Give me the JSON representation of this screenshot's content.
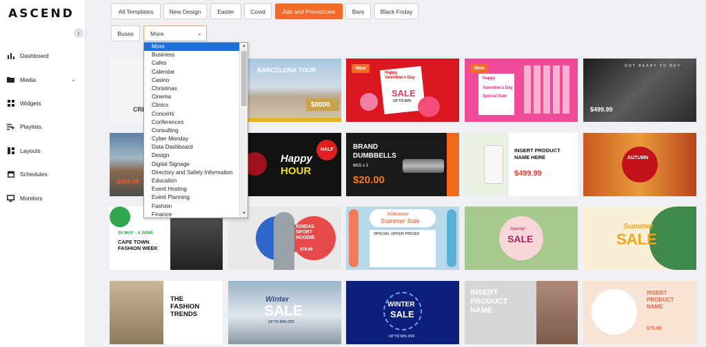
{
  "app": {
    "logo": "ASCEND",
    "collapse_icon": "chevron-left-icon"
  },
  "sidebar": {
    "items": [
      {
        "label": "Dashboard",
        "icon": "bar-chart-icon"
      },
      {
        "label": "Media",
        "icon": "folder-icon",
        "has_chevron": true
      },
      {
        "label": "Widgets",
        "icon": "grid-icon"
      },
      {
        "label": "Playlists",
        "icon": "playlist-icon"
      },
      {
        "label": "Layouts",
        "icon": "layout-icon"
      },
      {
        "label": "Schedules",
        "icon": "calendar-icon"
      },
      {
        "label": "Monitors",
        "icon": "monitor-icon"
      }
    ]
  },
  "filters": {
    "chips": [
      "All Templates",
      "New Design",
      "Easter",
      "Covid",
      "Ads and Promotions",
      "Bars",
      "Black Friday",
      "Buses"
    ],
    "active": "Ads and Promotions",
    "select_value": "More",
    "accent": "#f36b2a"
  },
  "dropdown": {
    "options": [
      "More",
      "Business",
      "Cafes",
      "Calendar",
      "Casino",
      "Christmas",
      "Cinema",
      "Clinics",
      "Concerts",
      "Conferences",
      "Consulting",
      "Cyber Monday",
      "Data Dashboard",
      "Design",
      "Digital Signage",
      "Directory and Safety Information",
      "Education",
      "Event Hosting",
      "Event Planning",
      "Fashion",
      "Finance"
    ],
    "selected": "More",
    "highlight": "#1e6fd9"
  },
  "templates": {
    "new_badge": "New",
    "c1": {
      "text": "CRE"
    },
    "c2": {
      "title": "BARCELONA TOUR",
      "price": "$0000"
    },
    "c3": {
      "line1": "Happy",
      "line2": "Valentine's Day",
      "sale": "SALE",
      "sub": "UP TO 50%"
    },
    "c4": {
      "line1": "Happy",
      "line2": "Valentine's Day",
      "line3": "Special Sale"
    },
    "c5": {
      "tag": "GOT READY TO BUY",
      "price": "$499.99"
    },
    "c6": {
      "price": "$499.99"
    },
    "c7": {
      "badge": "HALF",
      "line1": "Happy",
      "line2": "HOUR"
    },
    "c8": {
      "line1": "BRAND",
      "line2": "DUMBBELLS",
      "sub": "6KG x 2",
      "price": "$20.00"
    },
    "c9": {
      "line1": "INSERT PRODUCT",
      "line2": "NAME HERE",
      "price": "$499.99"
    },
    "c10": {
      "text": "AUTUMN"
    },
    "c11": {
      "dates": "30 MAY - 4 JUNE",
      "line1": "CAPE TOWN",
      "line2": "FASHION WEEK"
    },
    "c12": {
      "line1": "ADIDAS",
      "line2": "SPORT",
      "line3": "HOODIE",
      "price": "$79.99"
    },
    "c13": {
      "line1": "Kidswear",
      "line2": "Summer Sale",
      "sub": "SPECIAL OFFER PRICES"
    },
    "c14": {
      "line1": "Special",
      "line2": "SALE"
    },
    "c15": {
      "line1": "Summer",
      "line2": "SALE"
    },
    "c16": {
      "line1": "THE",
      "line2": "FASHION",
      "line3": "TRENDS"
    },
    "c17": {
      "line1": "Winter",
      "line2": "SALE",
      "sub": "UP TO 50% OFF"
    },
    "c18": {
      "line1": "WINTER",
      "line2": "SALE",
      "sub": "UP TO 50% OFF"
    },
    "c19": {
      "line1": "INSERT",
      "line2": "PRODUCT",
      "line3": "NAME"
    },
    "c20": {
      "line1": "INSERT",
      "line2": "PRODUCT",
      "line3": "NAME",
      "price": "$75.99"
    }
  }
}
